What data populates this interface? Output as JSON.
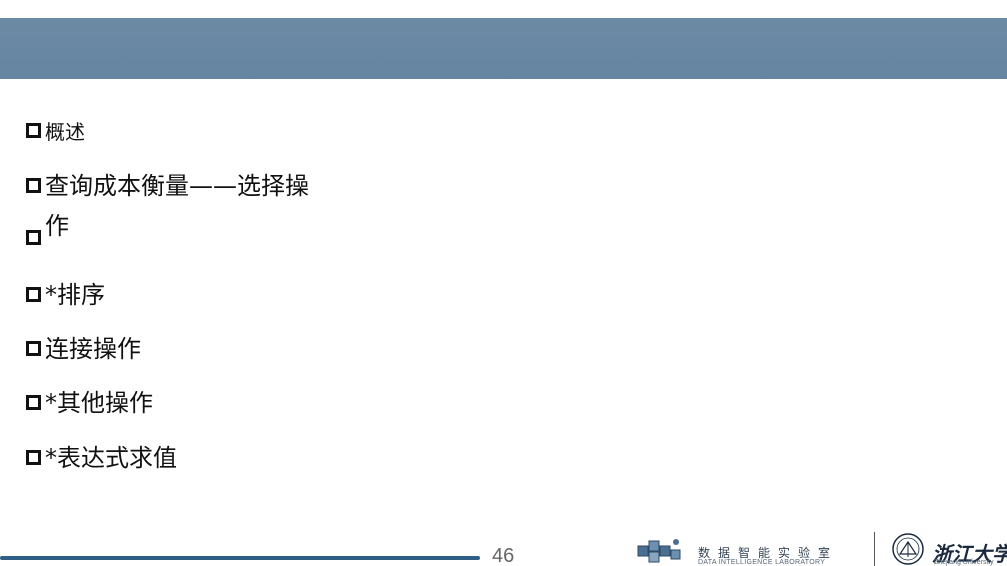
{
  "slide": {
    "bullets": [
      {
        "label": "概述"
      },
      {
        "label": "查询成本衡量——选择操"
      },
      {
        "label": "作"
      },
      {
        "label": "*排序"
      },
      {
        "label": "连接操作"
      },
      {
        "label": "*其他操作"
      },
      {
        "label": "*表达式求值"
      }
    ]
  },
  "footer": {
    "page_number": "46",
    "lab_name_cn": "数据智能实验室",
    "lab_name_en": "DATA INTELLIGENCE LABORATORY",
    "university_cn": "浙江大学",
    "university_en": "Zhejiang University"
  },
  "colors": {
    "header_bar": "#6b88a3",
    "footer_line": "#2f5f86",
    "text": "#111111"
  }
}
